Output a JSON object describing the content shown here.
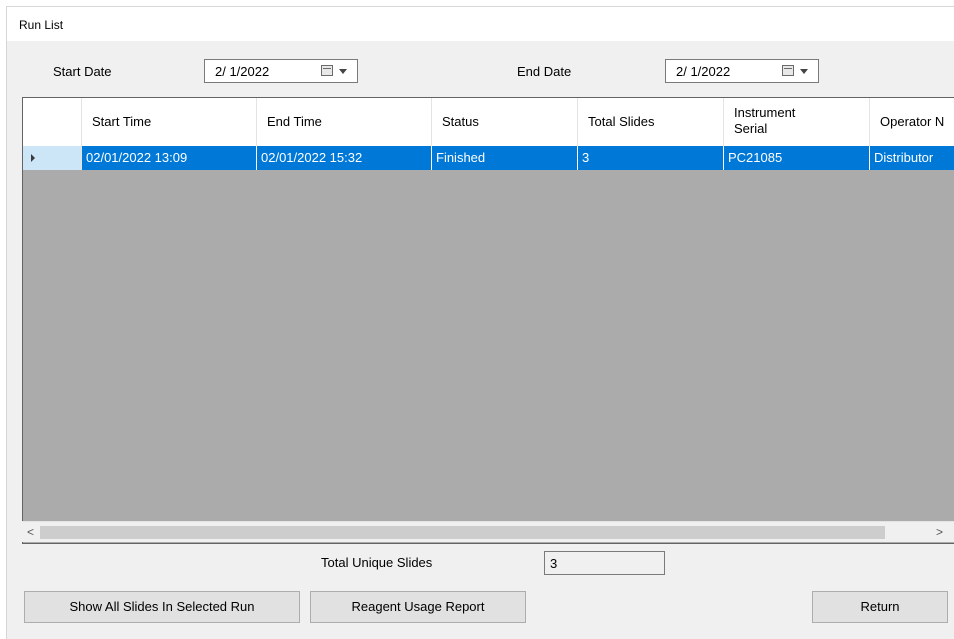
{
  "window": {
    "title": "Run List"
  },
  "filters": {
    "start_label": "Start Date",
    "start_value": "2/ 1/2022",
    "end_label": "End Date",
    "end_value": "2/ 1/2022"
  },
  "table": {
    "columns": [
      "Start Time",
      "End Time",
      "Status",
      "Total Slides",
      "Instrument Serial",
      "Operator N"
    ],
    "rows": [
      [
        "02/01/2022 13:09",
        "02/01/2022 15:32",
        "Finished",
        "3",
        "PC21085",
        "Distributor"
      ]
    ]
  },
  "totals": {
    "label": "Total Unique Slides",
    "value": "3"
  },
  "buttons": {
    "show_all": "Show All Slides In Selected Run",
    "reagent": "Reagent Usage Report",
    "return": "Return"
  },
  "scrollbar": {
    "left_arrow": "<",
    "right_arrow": ">"
  },
  "colors": {
    "selection": "#0078d7",
    "grid_bg": "#ababab"
  }
}
